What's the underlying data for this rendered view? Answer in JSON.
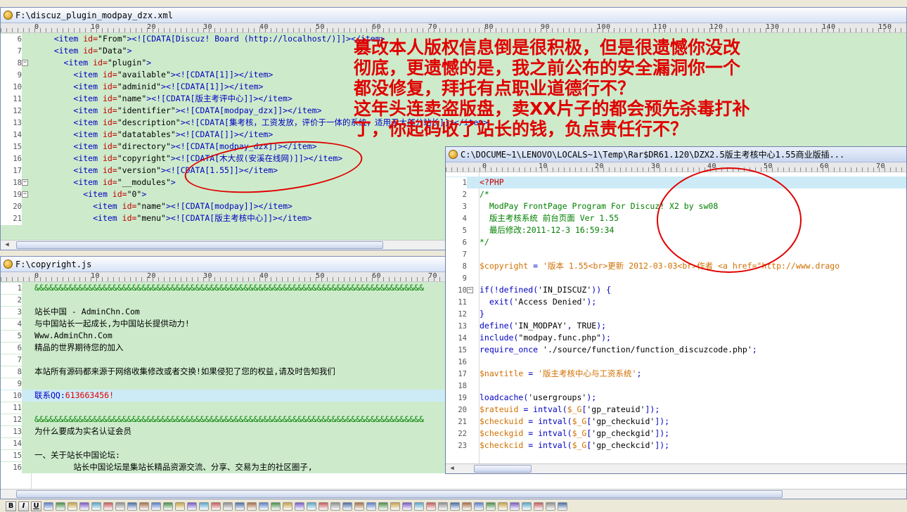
{
  "window1": {
    "title": "F:\\discuz_plugin_modpay_dzx.xml",
    "lines": [
      {
        "n": "6",
        "segs": [
          [
            "    ",
            ""
          ],
          [
            "<item ",
            "tag"
          ],
          [
            "id=",
            "attr"
          ],
          [
            "\"From\"",
            "str"
          ],
          [
            ">",
            "tag"
          ],
          [
            "<![CDATA[Discuz! Board (http://localhost/)]]></item>",
            "tag"
          ]
        ]
      },
      {
        "n": "7",
        "segs": [
          [
            "    ",
            ""
          ],
          [
            "<item ",
            "tag"
          ],
          [
            "id=",
            "attr"
          ],
          [
            "\"Data\"",
            "str"
          ],
          [
            ">",
            "tag"
          ]
        ]
      },
      {
        "n": "8",
        "fold": "−",
        "segs": [
          [
            "      ",
            ""
          ],
          [
            "<item ",
            "tag"
          ],
          [
            "id=",
            "attr"
          ],
          [
            "\"plugin\"",
            "str"
          ],
          [
            ">",
            "tag"
          ]
        ]
      },
      {
        "n": "9",
        "segs": [
          [
            "        ",
            ""
          ],
          [
            "<item ",
            "tag"
          ],
          [
            "id=",
            "attr"
          ],
          [
            "\"available\"",
            "str"
          ],
          [
            "><![CDATA[1]]></item>",
            "tag"
          ]
        ]
      },
      {
        "n": "10",
        "segs": [
          [
            "        ",
            ""
          ],
          [
            "<item ",
            "tag"
          ],
          [
            "id=",
            "attr"
          ],
          [
            "\"adminid\"",
            "str"
          ],
          [
            "><![CDATA[1]]></item>",
            "tag"
          ]
        ]
      },
      {
        "n": "11",
        "segs": [
          [
            "        ",
            ""
          ],
          [
            "<item ",
            "tag"
          ],
          [
            "id=",
            "attr"
          ],
          [
            "\"name\"",
            "str"
          ],
          [
            "><![CDATA[版主考评中心]]></item>",
            "tag"
          ]
        ]
      },
      {
        "n": "12",
        "segs": [
          [
            "        ",
            ""
          ],
          [
            "<item ",
            "tag"
          ],
          [
            "id=",
            "attr"
          ],
          [
            "\"identifier\"",
            "str"
          ],
          [
            "><![CDATA[modpay_dzx]]></item>",
            "tag"
          ]
        ]
      },
      {
        "n": "13",
        "segs": [
          [
            "        ",
            ""
          ],
          [
            "<item ",
            "tag"
          ],
          [
            "id=",
            "attr"
          ],
          [
            "\"description\"",
            "str"
          ],
          [
            "><![CDATA[集考核，工资发放，评价于一体的系统，适用于大部分站长]]></item>",
            "tag"
          ]
        ]
      },
      {
        "n": "14",
        "segs": [
          [
            "        ",
            ""
          ],
          [
            "<item ",
            "tag"
          ],
          [
            "id=",
            "attr"
          ],
          [
            "\"datatables\"",
            "str"
          ],
          [
            "><![CDATA[]]></item>",
            "tag"
          ]
        ]
      },
      {
        "n": "15",
        "segs": [
          [
            "        ",
            ""
          ],
          [
            "<item ",
            "tag"
          ],
          [
            "id=",
            "attr"
          ],
          [
            "\"directory\"",
            "str"
          ],
          [
            "><![CDATA[modpay_dzx]]></item>",
            "tag"
          ]
        ]
      },
      {
        "n": "16",
        "segs": [
          [
            "        ",
            ""
          ],
          [
            "<item ",
            "tag"
          ],
          [
            "id=",
            "attr"
          ],
          [
            "\"copyright\"",
            "str"
          ],
          [
            "><![CDATA[木大叔(安溪在线网)]]></item>",
            "tag"
          ]
        ]
      },
      {
        "n": "17",
        "segs": [
          [
            "        ",
            ""
          ],
          [
            "<item ",
            "tag"
          ],
          [
            "id=",
            "attr"
          ],
          [
            "\"version\"",
            "str"
          ],
          [
            "><![CDATA[1.55]]></item>",
            "tag"
          ]
        ]
      },
      {
        "n": "18",
        "fold": "−",
        "segs": [
          [
            "        ",
            ""
          ],
          [
            "<item ",
            "tag"
          ],
          [
            "id=",
            "attr"
          ],
          [
            "\"__modules\"",
            "str"
          ],
          [
            ">",
            "tag"
          ]
        ]
      },
      {
        "n": "19",
        "fold": "−",
        "segs": [
          [
            "          ",
            ""
          ],
          [
            "<item ",
            "tag"
          ],
          [
            "id=",
            "attr"
          ],
          [
            "\"0\"",
            "str"
          ],
          [
            ">",
            "tag"
          ]
        ]
      },
      {
        "n": "20",
        "segs": [
          [
            "            ",
            ""
          ],
          [
            "<item ",
            "tag"
          ],
          [
            "id=",
            "attr"
          ],
          [
            "\"name\"",
            "str"
          ],
          [
            "><![CDATA[modpay]]></item>",
            "tag"
          ]
        ]
      },
      {
        "n": "21",
        "segs": [
          [
            "            ",
            ""
          ],
          [
            "<item ",
            "tag"
          ],
          [
            "id=",
            "attr"
          ],
          [
            "\"menu\"",
            "str"
          ],
          [
            "><![CDATA[版主考核中心]]></item>",
            "tag"
          ]
        ]
      }
    ]
  },
  "window2": {
    "title": "F:\\copyright.js",
    "lines": [
      {
        "n": "1",
        "bg": "green",
        "segs": [
          [
            "&&&&&&&&&&&&&&&&&&&&&&&&&&&&&&&&&&&&&&&&&&&&&&&&&&&&&&&&&&&&&&&&&&&&&&&&&&&&&&&&",
            "cmt"
          ]
        ]
      },
      {
        "n": "2",
        "bg": "green",
        "segs": [
          [
            "",
            ""
          ]
        ]
      },
      {
        "n": "3",
        "bg": "green",
        "segs": [
          [
            "站长中国 - AdminChn.Com",
            ""
          ]
        ]
      },
      {
        "n": "4",
        "bg": "green",
        "segs": [
          [
            "与中国站长一起成长,为中国站长提供动力!",
            ""
          ]
        ]
      },
      {
        "n": "5",
        "bg": "green",
        "segs": [
          [
            "Www.AdminChn.Com",
            ""
          ]
        ]
      },
      {
        "n": "6",
        "bg": "green",
        "segs": [
          [
            "精品的世界期待您的加入",
            ""
          ]
        ]
      },
      {
        "n": "7",
        "bg": "green",
        "segs": [
          [
            "",
            ""
          ]
        ]
      },
      {
        "n": "8",
        "bg": "green",
        "segs": [
          [
            "本站所有源码都来源于网络收集修改或者交换!如果侵犯了您的权益,请及时告知我们",
            ""
          ]
        ]
      },
      {
        "n": "9",
        "bg": "green",
        "segs": [
          [
            "",
            ""
          ]
        ]
      },
      {
        "n": "10",
        "bg": "blue",
        "segs": [
          [
            "联系QQ:",
            "kw"
          ],
          [
            "613663456!",
            "red"
          ]
        ]
      },
      {
        "n": "11",
        "bg": "green",
        "segs": [
          [
            "",
            ""
          ]
        ]
      },
      {
        "n": "12",
        "bg": "green",
        "segs": [
          [
            "&&&&&&&&&&&&&&&&&&&&&&&&&&&&&&&&&&&&&&&&&&&&&&&&&&&&&&&&&&&&&&&&&&&&&&&&&&&&&&&&",
            "cmt"
          ]
        ]
      },
      {
        "n": "13",
        "bg": "green",
        "segs": [
          [
            "为什么要成为实名认证会员",
            ""
          ]
        ]
      },
      {
        "n": "14",
        "bg": "green",
        "segs": [
          [
            "",
            ""
          ]
        ]
      },
      {
        "n": "15",
        "bg": "green",
        "segs": [
          [
            "一、关于站长中国论坛:",
            ""
          ]
        ]
      },
      {
        "n": "16",
        "bg": "green",
        "segs": [
          [
            "        站长中国论坛是集站长精品资源交流、分享、交易为主的社区圈子,",
            ""
          ]
        ]
      }
    ]
  },
  "window3": {
    "title": "C:\\DOCUME~1\\LENOVO\\LOCALS~1\\Temp\\Rar$DR61.120\\DZX2.5版主考核中心1.55商业版插...",
    "lines": [
      {
        "n": "1",
        "bg": "blue",
        "segs": [
          [
            "<?PHP",
            "php"
          ]
        ]
      },
      {
        "n": "2",
        "segs": [
          [
            "/*",
            "cmt"
          ]
        ]
      },
      {
        "n": "3",
        "segs": [
          [
            "  ModPay FrontPage Program For Discuz! X2 by sw08",
            "cmt"
          ]
        ]
      },
      {
        "n": "4",
        "segs": [
          [
            "  版主考核系统 前台页面 Ver 1.55",
            "cmt"
          ]
        ]
      },
      {
        "n": "5",
        "segs": [
          [
            "  最后修改:2011-12-3 16:59:34",
            "cmt"
          ]
        ]
      },
      {
        "n": "6",
        "segs": [
          [
            "*/",
            "cmt"
          ]
        ]
      },
      {
        "n": "7",
        "segs": [
          [
            "",
            ""
          ]
        ]
      },
      {
        "n": "8",
        "segs": [
          [
            "$copyright",
            "var"
          ],
          [
            " = ",
            "kw"
          ],
          [
            "'版本 1.55<br>更新 2012-03-03<br>作者 <a href=\"http://www.drago",
            "var"
          ]
        ]
      },
      {
        "n": "9",
        "segs": [
          [
            "",
            ""
          ]
        ]
      },
      {
        "n": "10",
        "fold": "−",
        "segs": [
          [
            "if",
            "kw"
          ],
          [
            "(!",
            "kw"
          ],
          [
            "defined",
            "kw"
          ],
          [
            "(",
            "kw"
          ],
          [
            "'IN_DISCUZ'",
            ""
          ],
          [
            ")) {",
            "kw"
          ]
        ]
      },
      {
        "n": "11",
        "segs": [
          [
            "  ",
            ""
          ],
          [
            "exit",
            "kw"
          ],
          [
            "(",
            "kw"
          ],
          [
            "'Access Denied'",
            ""
          ],
          [
            ");",
            "kw"
          ]
        ]
      },
      {
        "n": "12",
        "segs": [
          [
            "}",
            "kw"
          ]
        ]
      },
      {
        "n": "13",
        "segs": [
          [
            "define",
            "kw"
          ],
          [
            "(",
            "kw"
          ],
          [
            "'IN_MODPAY'",
            ""
          ],
          [
            ", ",
            "kw"
          ],
          [
            "TRUE",
            ""
          ],
          [
            ");",
            "kw"
          ]
        ]
      },
      {
        "n": "14",
        "segs": [
          [
            "include",
            "kw"
          ],
          [
            "(",
            "kw"
          ],
          [
            "\"modpay.func.php\"",
            ""
          ],
          [
            ");",
            "kw"
          ]
        ]
      },
      {
        "n": "15",
        "segs": [
          [
            "require_once",
            "kw"
          ],
          [
            " ",
            ""
          ],
          [
            "'./source/function/function_discuzcode.php'",
            ""
          ],
          [
            ";",
            "kw"
          ]
        ]
      },
      {
        "n": "16",
        "segs": [
          [
            "",
            ""
          ]
        ]
      },
      {
        "n": "17",
        "segs": [
          [
            "$navtitle",
            "var"
          ],
          [
            " = ",
            "kw"
          ],
          [
            "'版主考核中心与工资系统'",
            "var"
          ],
          [
            ";",
            "kw"
          ]
        ]
      },
      {
        "n": "18",
        "segs": [
          [
            "",
            ""
          ]
        ]
      },
      {
        "n": "19",
        "segs": [
          [
            "loadcache",
            "kw"
          ],
          [
            "(",
            "kw"
          ],
          [
            "'usergroups'",
            ""
          ],
          [
            ");",
            "kw"
          ]
        ]
      },
      {
        "n": "20",
        "segs": [
          [
            "$rateuid",
            "var"
          ],
          [
            " = ",
            "kw"
          ],
          [
            "intval",
            "kw"
          ],
          [
            "(",
            "kw"
          ],
          [
            "$_G",
            "var"
          ],
          [
            "[",
            "kw"
          ],
          [
            "'gp_rateuid'",
            ""
          ],
          [
            "]);",
            "kw"
          ]
        ]
      },
      {
        "n": "21",
        "segs": [
          [
            "$checkuid",
            "var"
          ],
          [
            " = ",
            "kw"
          ],
          [
            "intval",
            "kw"
          ],
          [
            "(",
            "kw"
          ],
          [
            "$_G",
            "var"
          ],
          [
            "[",
            "kw"
          ],
          [
            "'gp_checkuid'",
            ""
          ],
          [
            "]);",
            "kw"
          ]
        ]
      },
      {
        "n": "22",
        "segs": [
          [
            "$checkgid",
            "var"
          ],
          [
            " = ",
            "kw"
          ],
          [
            "intval",
            "kw"
          ],
          [
            "(",
            "kw"
          ],
          [
            "$_G",
            "var"
          ],
          [
            "[",
            "kw"
          ],
          [
            "'gp_checkgid'",
            ""
          ],
          [
            "]);",
            "kw"
          ]
        ]
      },
      {
        "n": "23",
        "segs": [
          [
            "$checkcid",
            "var"
          ],
          [
            " = ",
            "kw"
          ],
          [
            "intval",
            "kw"
          ],
          [
            "(",
            "kw"
          ],
          [
            "$_G",
            "var"
          ],
          [
            "[",
            "kw"
          ],
          [
            "'gp_checkcid'",
            ""
          ],
          [
            "]);",
            "kw"
          ]
        ]
      }
    ]
  },
  "ruler_marks_main": [
    "0",
    "10",
    "20",
    "30",
    "40",
    "50",
    "60",
    "70",
    "80",
    "90",
    "100",
    "110",
    "120",
    "130",
    "140",
    "150"
  ],
  "ruler_marks_php": [
    "0",
    "10",
    "20",
    "30",
    "40",
    "50",
    "60",
    "70"
  ],
  "overlay_lines": [
    "篡改本人版权信息倒是很积极，但是很遗憾你没改",
    "彻底，更遗憾的是，我之前公布的安全漏洞你一个",
    "都没修复，拜托有点职业道德行不？",
    "这年头连卖盗版盘，卖XX片子的都会预先杀毒打补",
    "丁，你起码收了站长的钱，负点责任行不？"
  ],
  "toolbar": {
    "bold": "B",
    "italic": "I",
    "underline": "U"
  },
  "colors": {
    "xml_bg": "#CDEBCB",
    "accent_red": "#E00000",
    "highlight_line": "#CDEBF7"
  }
}
